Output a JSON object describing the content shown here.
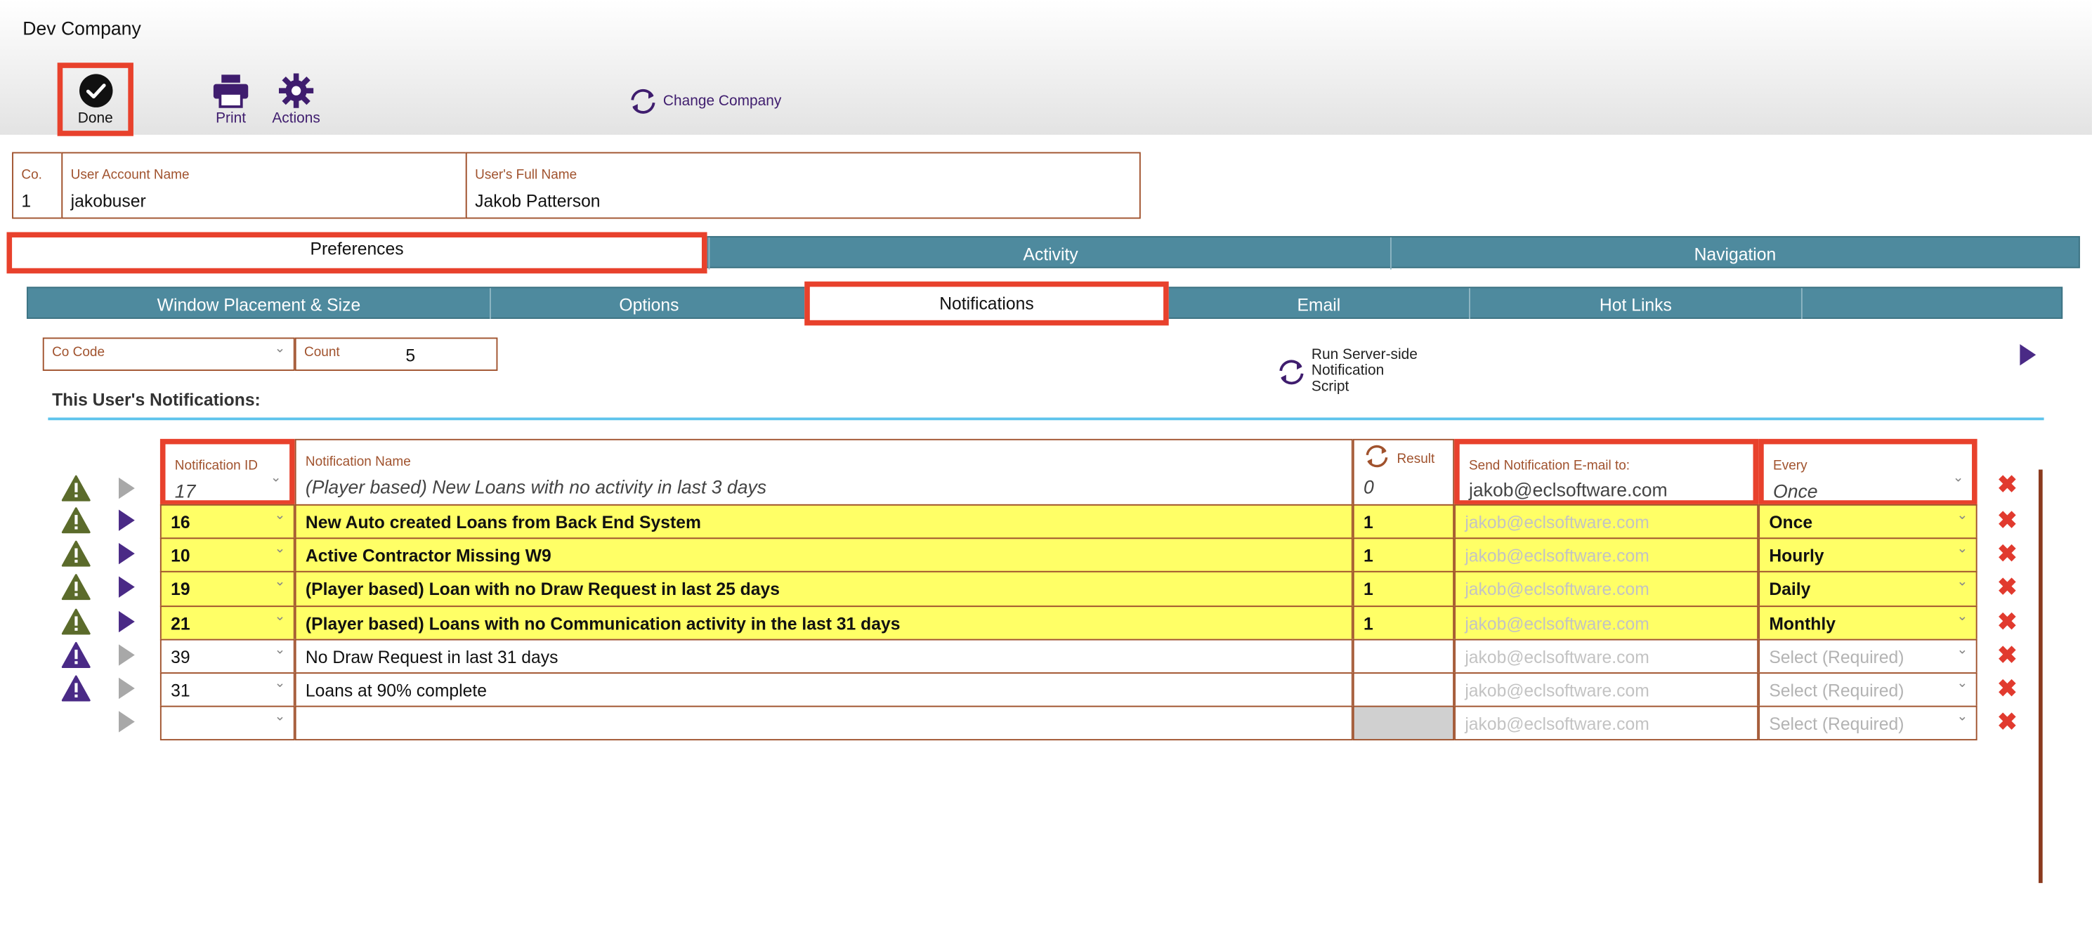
{
  "header": {
    "company": "Dev Company",
    "done_label": "Done",
    "print_label": "Print",
    "actions_label": "Actions",
    "change_company_label": "Change Company"
  },
  "user": {
    "co_label": "Co.",
    "co_value": "1",
    "account_label": "User Account Name",
    "account_value": "jakobuser",
    "fullname_label": "User's Full Name",
    "fullname_value": "Jakob Patterson"
  },
  "tabs_main": [
    "Preferences",
    "Activity",
    "Navigation"
  ],
  "tabs_sub": [
    "Window Placement & Size",
    "Options",
    "Notifications",
    "Email",
    "Hot Links",
    ""
  ],
  "filters": {
    "cocode_label": "Co Code",
    "count_label": "Count",
    "count_value": "5"
  },
  "run_script_label": [
    "Run Server-side",
    "Notification",
    "Script"
  ],
  "section_title": "This User's Notifications:",
  "columns": {
    "id": "Notification ID",
    "name": "Notification Name",
    "result": "Result",
    "email": "Send Notification E-mail to:",
    "every": "Every"
  },
  "header_row": {
    "id": "17",
    "name": "(Player based) New Loans with no activity in last 3 days",
    "result": "0",
    "email": "jakob@eclsoftware.com",
    "every": "Once"
  },
  "rows": [
    {
      "id": "16",
      "name": "New Auto created Loans from Back End System",
      "result": "1",
      "email": "jakob@eclsoftware.com",
      "every": "Once",
      "highlight": true,
      "warn": "green",
      "play": "purple"
    },
    {
      "id": "10",
      "name": "Active Contractor Missing W9",
      "result": "1",
      "email": "jakob@eclsoftware.com",
      "every": "Hourly",
      "highlight": true,
      "warn": "green",
      "play": "purple"
    },
    {
      "id": "19",
      "name": "(Player based) Loan with no Draw Request in last 25 days",
      "result": "1",
      "email": "jakob@eclsoftware.com",
      "every": "Daily",
      "highlight": true,
      "warn": "green",
      "play": "purple"
    },
    {
      "id": "21",
      "name": "(Player based) Loans with no Communication activity in the last 31 days",
      "result": "1",
      "email": "jakob@eclsoftware.com",
      "every": "Monthly",
      "highlight": true,
      "warn": "green",
      "play": "purple"
    },
    {
      "id": "39",
      "name": "No Draw Request in last 31 days",
      "result": "",
      "email": "jakob@eclsoftware.com",
      "every": "Select (Required)",
      "highlight": false,
      "warn": "purple",
      "play": "gray"
    },
    {
      "id": "31",
      "name": "Loans at 90% complete",
      "result": "",
      "email": "jakob@eclsoftware.com",
      "every": "Select (Required)",
      "highlight": false,
      "warn": "purple",
      "play": "gray"
    },
    {
      "id": "",
      "name": "",
      "result": "",
      "email": "jakob@eclsoftware.com",
      "every": "Select (Required)",
      "highlight": false,
      "warn": "none",
      "play": "gray"
    }
  ],
  "colors": {
    "highlight_box": "#e8412c",
    "tab_bar": "#4e8a9e",
    "field_border": "#a0522d",
    "row_yellow": "#ffff66",
    "warn_green": "#5b6b2b",
    "warn_purple": "#4a2a86",
    "delete_red": "#e13a2e"
  }
}
